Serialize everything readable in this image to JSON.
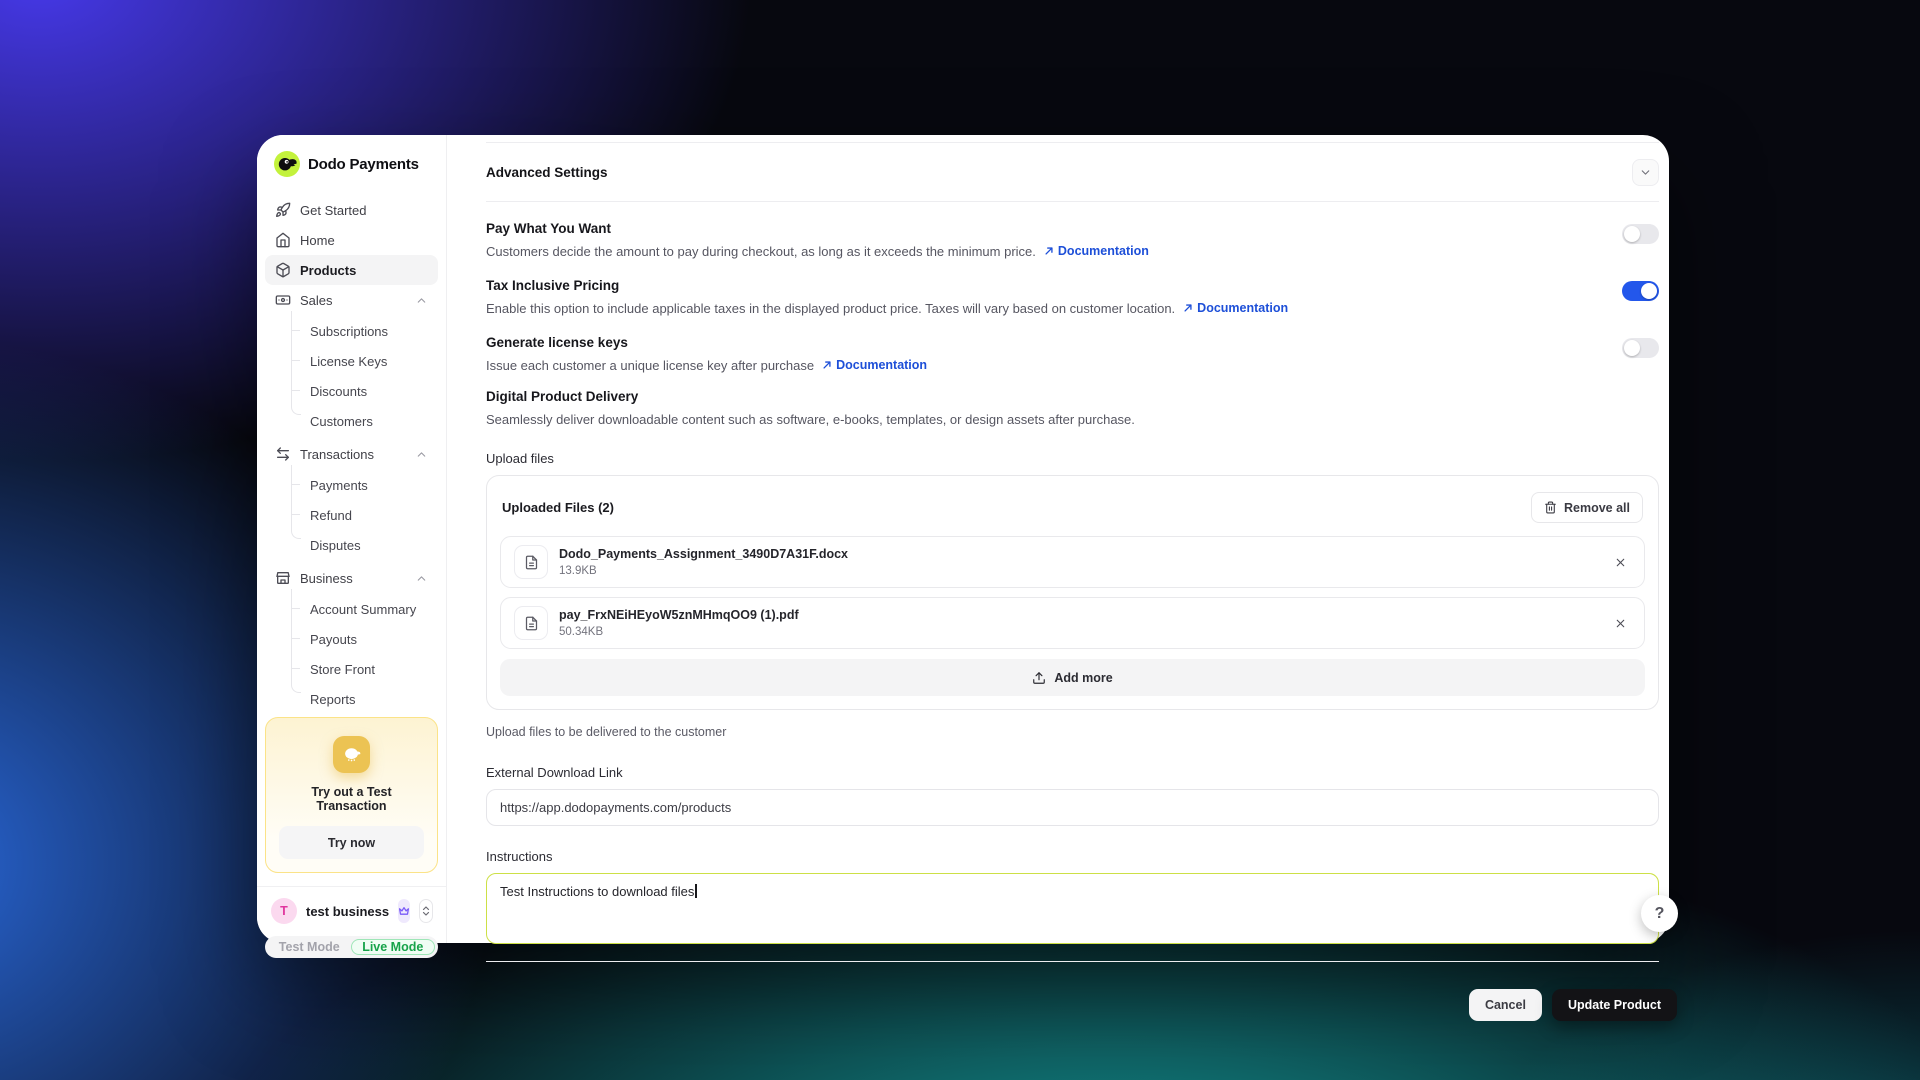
{
  "brand": {
    "name": "Dodo Payments",
    "lime": "#c3f23c"
  },
  "sidebar": {
    "items": [
      {
        "label": "Get Started",
        "icon": "rocket-icon"
      },
      {
        "label": "Home",
        "icon": "home-icon"
      },
      {
        "label": "Products",
        "icon": "package-icon",
        "active": true
      },
      {
        "label": "Sales",
        "icon": "banknote-icon",
        "expanded": true,
        "children": [
          "Subscriptions",
          "License Keys",
          "Discounts",
          "Customers"
        ]
      },
      {
        "label": "Transactions",
        "icon": "arrows-swap-icon",
        "expanded": true,
        "children": [
          "Payments",
          "Refund",
          "Disputes"
        ]
      },
      {
        "label": "Business",
        "icon": "storefront-icon",
        "expanded": true,
        "children": [
          "Account Summary",
          "Payouts",
          "Store Front",
          "Reports"
        ]
      }
    ],
    "promo": {
      "title": "Try out a Test Transaction",
      "button": "Try now"
    },
    "account": {
      "initial": "T",
      "name": "test business"
    },
    "mode": {
      "test": "Test Mode",
      "live": "Live Mode",
      "active": "Live Mode",
      "live_color": "#17a34a"
    }
  },
  "main": {
    "advanced_settings_title": "Advanced Settings",
    "settings": [
      {
        "title": "Pay What You Want",
        "desc": "Customers decide the amount to pay during checkout, as long as it exceeds the minimum price.",
        "doc": "Documentation",
        "state": "off"
      },
      {
        "title": "Tax Inclusive Pricing",
        "desc": "Enable this option to include applicable taxes in the displayed product price. Taxes will vary based on customer location.",
        "doc": "Documentation",
        "state": "on"
      },
      {
        "title": "Generate license keys",
        "desc": "Issue each customer a unique license key after purchase",
        "doc": "Documentation",
        "state": "off"
      }
    ],
    "delivery": {
      "title": "Digital Product Delivery",
      "desc": "Seamlessly deliver downloadable content such as software, e-books, templates, or design assets after purchase."
    },
    "upload": {
      "label": "Upload files",
      "header": "Uploaded Files (2)",
      "remove_all": "Remove all",
      "files": [
        {
          "name": "Dodo_Payments_Assignment_3490D7A31F.docx",
          "size": "13.9KB"
        },
        {
          "name": "pay_FrxNEiHEyoW5znMHmqOO9 (1).pdf",
          "size": "50.34KB"
        }
      ],
      "add_more": "Add more",
      "caption": "Upload files to be delivered to the customer"
    },
    "external_link": {
      "label": "External Download Link",
      "value": "https://app.dodopayments.com/products"
    },
    "instructions": {
      "label": "Instructions",
      "value": "Test Instructions to download files"
    },
    "footer": {
      "cancel": "Cancel",
      "update": "Update Product"
    },
    "help": "?",
    "accent_toggle_on": "#2357eb",
    "accent_link": "#1d4fd8",
    "textarea_focus_border": "#cde046"
  }
}
